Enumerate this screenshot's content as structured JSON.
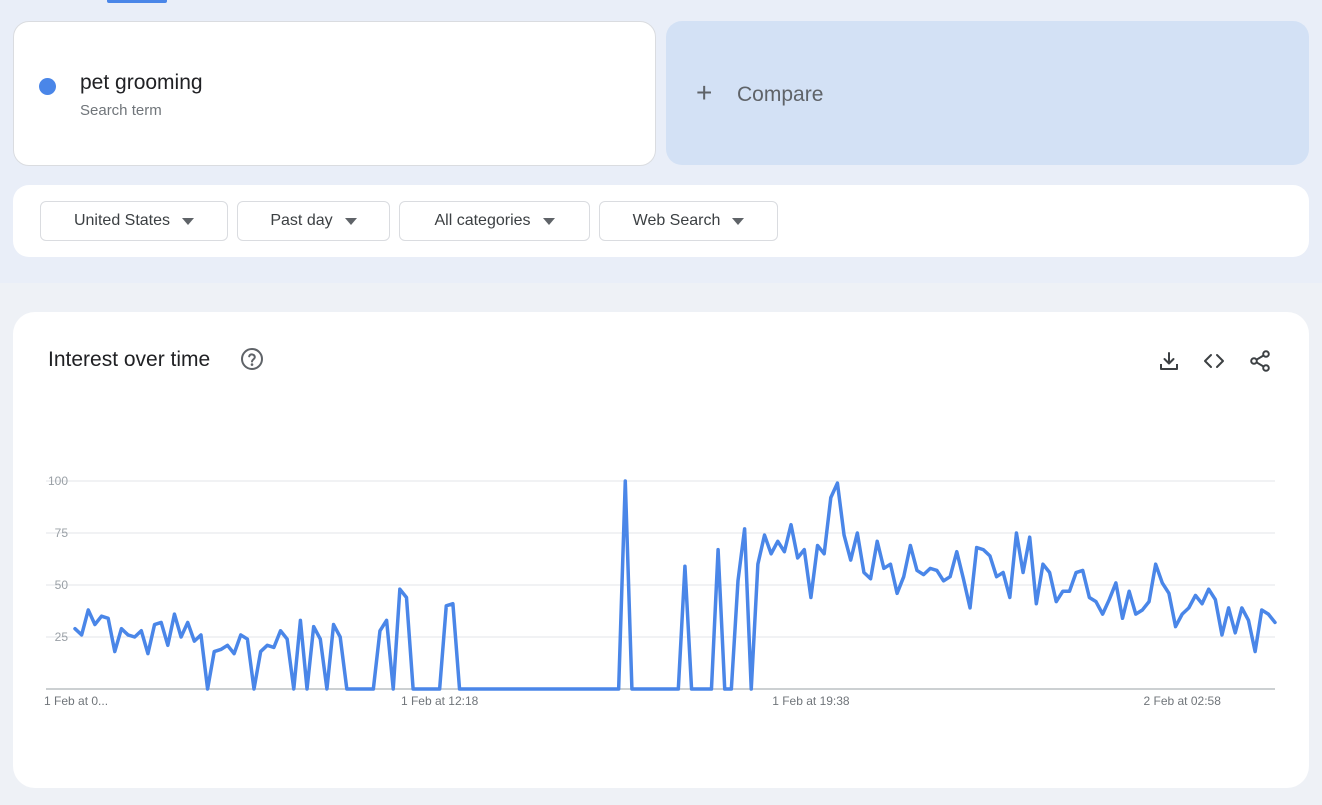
{
  "search_term": {
    "name": "pet grooming",
    "type_label": "Search term",
    "color": "#4a86e8"
  },
  "compare": {
    "icon": "plus-icon",
    "label": "Compare"
  },
  "filters": [
    {
      "label": "United States"
    },
    {
      "label": "Past day"
    },
    {
      "label": "All categories"
    },
    {
      "label": "Web Search"
    }
  ],
  "interest_panel": {
    "title": "Interest over time",
    "icons": [
      "help-icon",
      "download-icon",
      "embed-code-icon",
      "share-icon"
    ]
  },
  "chart_data": {
    "type": "line",
    "ylim": [
      0,
      100
    ],
    "yticks": [
      25,
      50,
      75,
      100
    ],
    "grid": true,
    "xtick_labels": [
      "1 Feb at 0...",
      "1 Feb at 12:18",
      "1 Feb at 19:38",
      "2 Feb at 02:58"
    ],
    "xtick_index": [
      0,
      55,
      111,
      167
    ],
    "series": [
      {
        "color": "#4a86e8",
        "values": [
          29,
          26,
          38,
          31,
          35,
          34,
          18,
          29,
          26,
          25,
          28,
          17,
          31,
          32,
          21,
          36,
          25,
          32,
          23,
          26,
          0,
          18,
          19,
          21,
          17,
          26,
          24,
          0,
          18,
          21,
          20,
          28,
          24,
          0,
          33,
          0,
          30,
          24,
          0,
          31,
          25,
          0,
          0,
          0,
          0,
          0,
          28,
          33,
          0,
          48,
          44,
          0,
          0,
          0,
          0,
          0,
          40,
          41,
          0,
          0,
          0,
          0,
          0,
          0,
          0,
          0,
          0,
          0,
          0,
          0,
          0,
          0,
          0,
          0,
          0,
          0,
          0,
          0,
          0,
          0,
          0,
          0,
          0,
          100,
          0,
          0,
          0,
          0,
          0,
          0,
          0,
          0,
          59,
          0,
          0,
          0,
          0,
          67,
          0,
          0,
          52,
          77,
          0,
          60,
          74,
          65,
          71,
          66,
          79,
          63,
          67,
          44,
          69,
          65,
          92,
          99,
          74,
          62,
          75,
          56,
          53,
          71,
          58,
          60,
          46,
          54,
          69,
          57,
          55,
          58,
          57,
          52,
          54,
          66,
          53,
          39,
          68,
          67,
          64,
          54,
          56,
          44,
          75,
          56,
          73,
          41,
          60,
          56,
          42,
          47,
          47,
          56,
          57,
          44,
          42,
          36,
          43,
          51,
          34,
          47,
          36,
          38,
          42,
          60,
          51,
          46,
          30,
          36,
          39,
          45,
          41,
          48,
          43,
          26,
          39,
          27,
          39,
          33,
          18,
          38,
          36,
          32
        ]
      }
    ]
  }
}
